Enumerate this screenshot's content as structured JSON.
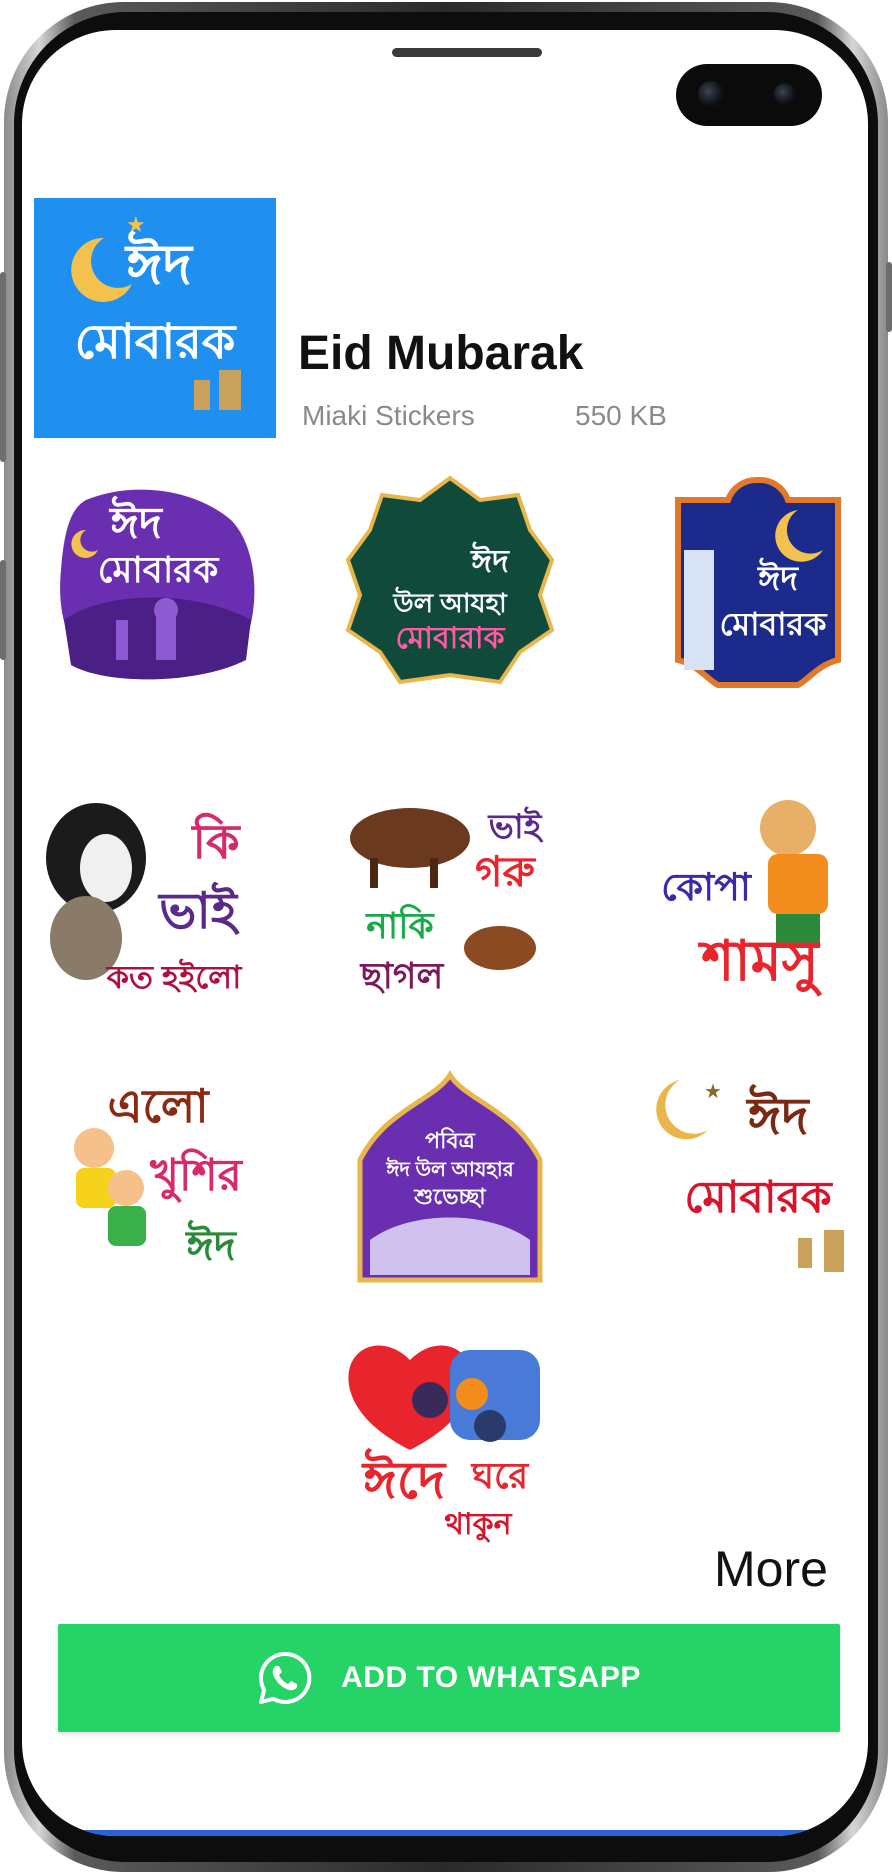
{
  "pack": {
    "title": "Eid Mubarak",
    "publisher": "Miaki Stickers",
    "size": "550 KB",
    "icon_text_line1": "ঈদ",
    "icon_text_line2": "মোবারক"
  },
  "stickers": [
    {
      "lines": [
        "ঈদ",
        "মোবারক"
      ]
    },
    {
      "lines": [
        "ঈদ",
        "উল আযহা",
        "মোবারাক"
      ]
    },
    {
      "lines": [
        "ঈদ",
        "মোবারক"
      ]
    },
    {
      "lines": [
        "কি",
        "ভাই",
        "কত হইলো"
      ]
    },
    {
      "lines": [
        "ভাই",
        "গরু",
        "নাকি",
        "ছাগল"
      ]
    },
    {
      "lines": [
        "কোপা",
        "শামসু"
      ]
    },
    {
      "lines": [
        "এলো",
        "খুশির",
        "ঈদ"
      ]
    },
    {
      "lines": [
        "পবিত্র",
        "ঈদ উল আযহার",
        "শুভেচ্ছা"
      ]
    },
    {
      "lines": [
        "ঈদ",
        "মোবারক"
      ]
    },
    {
      "lines": [
        "ঈদে",
        "ঘরে",
        "থাকুন"
      ]
    }
  ],
  "more_label": "More",
  "add_button": {
    "label": "ADD TO WHATSAPP",
    "icon": "whatsapp-icon"
  },
  "colors": {
    "whatsapp_green": "#26d367",
    "icon_blue": "#1f8ff0"
  }
}
